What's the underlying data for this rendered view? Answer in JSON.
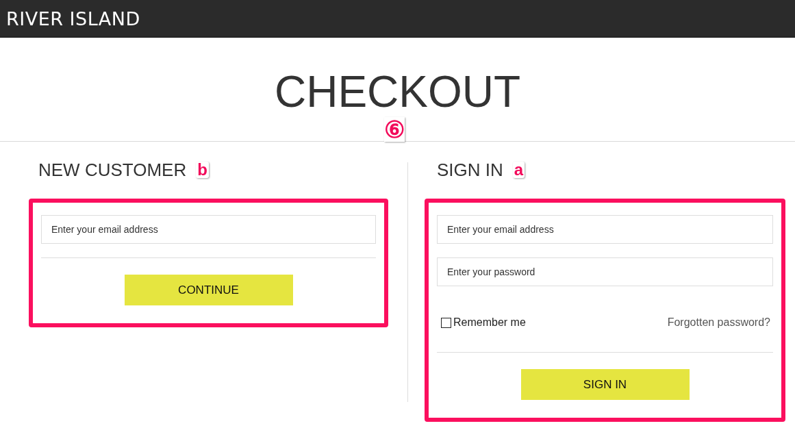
{
  "header": {
    "logo": "RIVER ISLAND"
  },
  "title": "CHECKOUT",
  "title_marker": "⑥",
  "new_customer": {
    "heading": "NEW CUSTOMER",
    "marker": "b",
    "email": {
      "placeholder": "Enter your email address"
    },
    "button": "CONTINUE"
  },
  "sign_in": {
    "heading": "SIGN IN",
    "marker": "a",
    "email": {
      "placeholder": "Enter your email address"
    },
    "password": {
      "placeholder": "Enter your password"
    },
    "remember": {
      "label": "Remember me",
      "checked": false
    },
    "forgot_link": "Forgotten password?",
    "button": "SIGN IN"
  }
}
